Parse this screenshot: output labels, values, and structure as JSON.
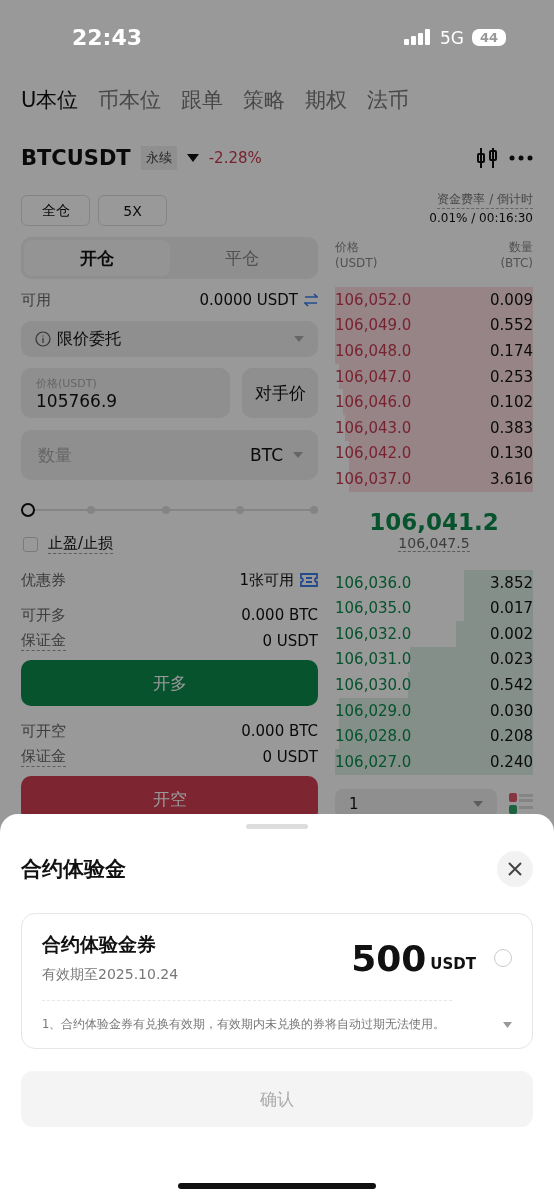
{
  "status_bar": {
    "time": "22:43",
    "network": "5G",
    "battery": "44"
  },
  "tabs": [
    {
      "label": "U本位",
      "selected": true
    },
    {
      "label": "币本位",
      "selected": false
    },
    {
      "label": "跟单",
      "selected": false
    },
    {
      "label": "策略",
      "selected": false
    },
    {
      "label": "期权",
      "selected": false
    },
    {
      "label": "法币",
      "selected": false
    }
  ],
  "symbol": {
    "name": "BTCUSDT",
    "badge": "永续",
    "change": "-2.28%"
  },
  "margin_mode": "全仓",
  "leverage": "5X",
  "funding": {
    "label": "资金费率 / 倒计时",
    "value": "0.01% / 00:16:30"
  },
  "order_tabs": [
    {
      "label": "开仓",
      "selected": true
    },
    {
      "label": "平仓",
      "selected": false
    }
  ],
  "available": {
    "label": "可用",
    "value": "0.0000 USDT"
  },
  "order_type": "限价委托",
  "price_field": {
    "label": "价格(USDT)",
    "value": "105766.9"
  },
  "counter_price": "对手价",
  "quantity_field": {
    "placeholder": "数量",
    "unit": "BTC"
  },
  "slider": {
    "level": 0
  },
  "tp_sl": {
    "label": "止盈/止损",
    "checked": false
  },
  "coupon": {
    "label": "优惠券",
    "value": "1张可用"
  },
  "long": {
    "rows": [
      {
        "label": "可开多",
        "value": "0.000 BTC"
      },
      {
        "label": "保证金",
        "value": "0 USDT"
      }
    ],
    "button": "开多"
  },
  "short": {
    "rows": [
      {
        "label": "可开空",
        "value": "0.000 BTC"
      },
      {
        "label": "保证金",
        "value": "0 USDT"
      }
    ],
    "button": "开空"
  },
  "order_book": {
    "headers": [
      {
        "label": "价格",
        "unit": "(USDT)"
      },
      {
        "label": "数量",
        "unit": "(BTC)"
      }
    ],
    "asks": [
      {
        "price": "106,052.0",
        "qty": "0.009"
      },
      {
        "price": "106,049.0",
        "qty": "0.552"
      },
      {
        "price": "106,048.0",
        "qty": "0.174"
      },
      {
        "price": "106,047.0",
        "qty": "0.253"
      },
      {
        "price": "106,046.0",
        "qty": "0.102"
      },
      {
        "price": "106,043.0",
        "qty": "0.383"
      },
      {
        "price": "106,042.0",
        "qty": "0.130"
      },
      {
        "price": "106,037.0",
        "qty": "3.616"
      }
    ],
    "last_price": "106,041.2",
    "mark_price": "106,047.5",
    "bids": [
      {
        "price": "106,036.0",
        "qty": "3.852"
      },
      {
        "price": "106,035.0",
        "qty": "0.017"
      },
      {
        "price": "106,032.0",
        "qty": "0.002"
      },
      {
        "price": "106,031.0",
        "qty": "0.023"
      },
      {
        "price": "106,030.0",
        "qty": "0.542"
      },
      {
        "price": "106,029.0",
        "qty": "0.030"
      },
      {
        "price": "106,028.0",
        "qty": "0.208"
      },
      {
        "price": "106,027.0",
        "qty": "0.240"
      }
    ],
    "depth_select": "1"
  },
  "sheet": {
    "title": "合约体验金",
    "coupons": [
      {
        "title": "合约体验金券",
        "expiry": "有效期至2025.10.24",
        "amount": "500",
        "unit": "USDT",
        "selected": false,
        "note": "1、合约体验金券有兑换有效期，有效期内未兑换的券将自动过期无法使用。"
      }
    ],
    "confirm": {
      "label": "确认",
      "disabled": true
    }
  }
}
